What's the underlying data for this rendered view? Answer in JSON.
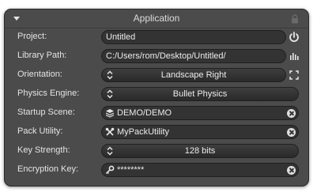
{
  "window": {
    "title": "Application"
  },
  "icons": {
    "collapse": "triangle-down-icon",
    "lock": "lock-icon",
    "power": "power-icon",
    "browse": "bar-chart-icon",
    "fullscreen": "fullscreen-corners-icon",
    "updown": "updown-chevron-icon",
    "layers": "layers-icon",
    "tools": "tools-icon",
    "key": "key-icon",
    "clear": "clear-x-icon"
  },
  "fields": {
    "project": {
      "label": "Project:",
      "value": "Untitled"
    },
    "library_path": {
      "label": "Library Path:",
      "value": "C:/Users/rom/Desktop/Untitled/"
    },
    "orientation": {
      "label": "Orientation:",
      "value": "Landscape Right"
    },
    "physics_engine": {
      "label": "Physics Engine:",
      "value": "Bullet Physics"
    },
    "startup_scene": {
      "label": "Startup Scene:",
      "value": "DEMO/DEMO"
    },
    "pack_utility": {
      "label": "Pack Utility:",
      "value": "MyPackUtility"
    },
    "key_strength": {
      "label": "Key Strength:",
      "value": "128 bits"
    },
    "encryption_key": {
      "label": "Encryption Key:",
      "value": "********"
    }
  },
  "colors": {
    "panel": "#4b4b4b",
    "field": "#333333",
    "text": "#ececec"
  }
}
